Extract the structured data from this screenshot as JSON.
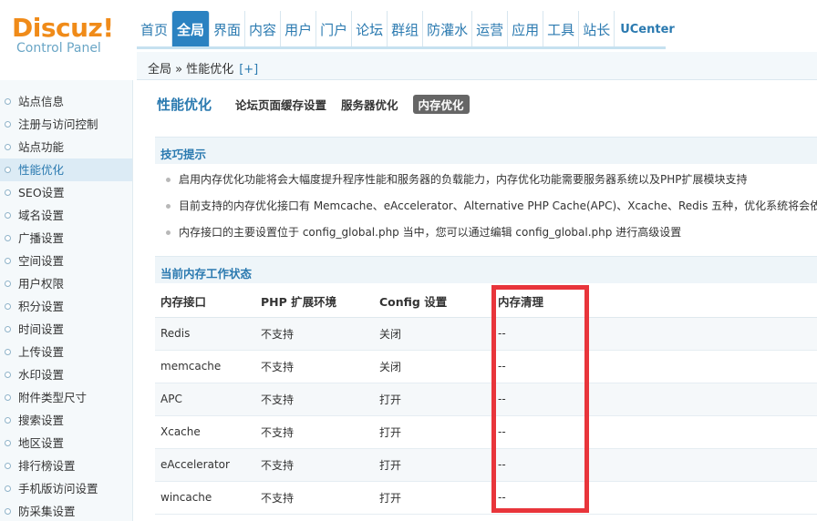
{
  "logo": {
    "word": "Discuz!",
    "subtitle": "Control Panel"
  },
  "nav": {
    "items": [
      {
        "label": "首页"
      },
      {
        "label": "全局",
        "active": true
      },
      {
        "label": "界面"
      },
      {
        "label": "内容"
      },
      {
        "label": "用户"
      },
      {
        "label": "门户"
      },
      {
        "label": "论坛"
      },
      {
        "label": "群组"
      },
      {
        "label": "防灌水"
      },
      {
        "label": "运营"
      },
      {
        "label": "应用"
      },
      {
        "label": "工具"
      },
      {
        "label": "站长"
      },
      {
        "label": "UCenter"
      }
    ]
  },
  "breadcrumb": {
    "text": "全局 » 性能优化",
    "plus": "[+]"
  },
  "sidebar": {
    "items": [
      {
        "label": "站点信息"
      },
      {
        "label": "注册与访问控制"
      },
      {
        "label": "站点功能"
      },
      {
        "label": "性能优化",
        "active": true
      },
      {
        "label": "SEO设置"
      },
      {
        "label": "域名设置"
      },
      {
        "label": "广播设置"
      },
      {
        "label": "空间设置"
      },
      {
        "label": "用户权限"
      },
      {
        "label": "积分设置"
      },
      {
        "label": "时间设置"
      },
      {
        "label": "上传设置"
      },
      {
        "label": "水印设置"
      },
      {
        "label": "附件类型尺寸"
      },
      {
        "label": "搜索设置"
      },
      {
        "label": "地区设置"
      },
      {
        "label": "排行榜设置"
      },
      {
        "label": "手机版访问设置"
      },
      {
        "label": "防采集设置"
      }
    ]
  },
  "page": {
    "title": "性能优化",
    "tabs": [
      {
        "label": "论坛页面缓存设置"
      },
      {
        "label": "服务器优化"
      },
      {
        "label": "内存优化",
        "current": true
      }
    ]
  },
  "tips": {
    "heading": "技巧提示",
    "items": [
      "启用内存优化功能将会大幅度提升程序性能和服务器的负载能力，内存优化功能需要服务器系统以及PHP扩展模块支持",
      "目前支持的内存优化接口有 Memcache、eAccelerator、Alternative PHP Cache(APC)、Xcache、Redis 五种，优化系统将会依据当前",
      "内存接口的主要设置位于 config_global.php 当中，您可以通过编辑 config_global.php 进行高级设置"
    ]
  },
  "status": {
    "heading": "当前内存工作状态",
    "columns": [
      "内存接口",
      "PHP 扩展环境",
      "Config 设置",
      "内存清理"
    ],
    "rows": [
      [
        "Redis",
        "不支持",
        "关闭",
        "--"
      ],
      [
        "memcache",
        "不支持",
        "关闭",
        "--"
      ],
      [
        "APC",
        "不支持",
        "打开",
        "--"
      ],
      [
        "Xcache",
        "不支持",
        "打开",
        "--"
      ],
      [
        "eAccelerator",
        "不支持",
        "打开",
        "--"
      ],
      [
        "wincache",
        "不支持",
        "打开",
        "--"
      ]
    ]
  },
  "colors": {
    "accent": "#2b7ab0",
    "logo": "#f08b19",
    "highlight": "#e8353b"
  }
}
